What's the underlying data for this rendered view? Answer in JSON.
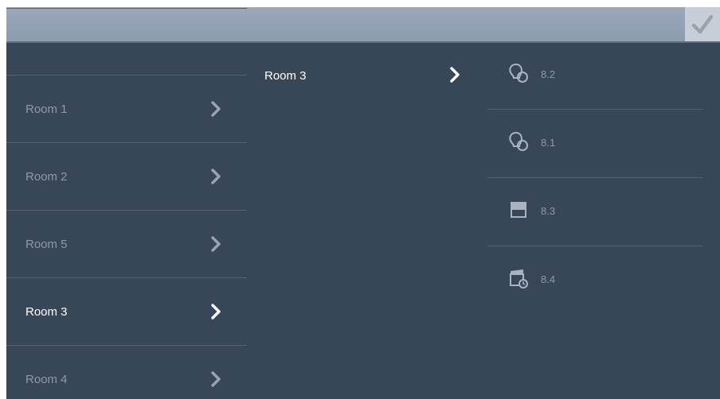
{
  "header": {
    "confirm_icon": "checkmark-icon"
  },
  "rooms": [
    {
      "label": "",
      "active": false
    },
    {
      "label": "Room 1",
      "active": false
    },
    {
      "label": "Room 2",
      "active": false
    },
    {
      "label": "Room 5",
      "active": false
    },
    {
      "label": "Room 3",
      "active": true
    },
    {
      "label": "Room 4",
      "active": false
    }
  ],
  "selected_room": {
    "label": "Room 3"
  },
  "devices": [
    {
      "label": "8.2",
      "icon": "light-bulb-icon"
    },
    {
      "label": "8.1",
      "icon": "light-bulb-icon"
    },
    {
      "label": "8.3",
      "icon": "blind-icon"
    },
    {
      "label": "8.4",
      "icon": "scene-timer-icon"
    }
  ],
  "colors": {
    "background": "#384758",
    "header": "#8d9bb0",
    "active_text": "#ffffff",
    "inactive_text": "#8e99a6"
  }
}
